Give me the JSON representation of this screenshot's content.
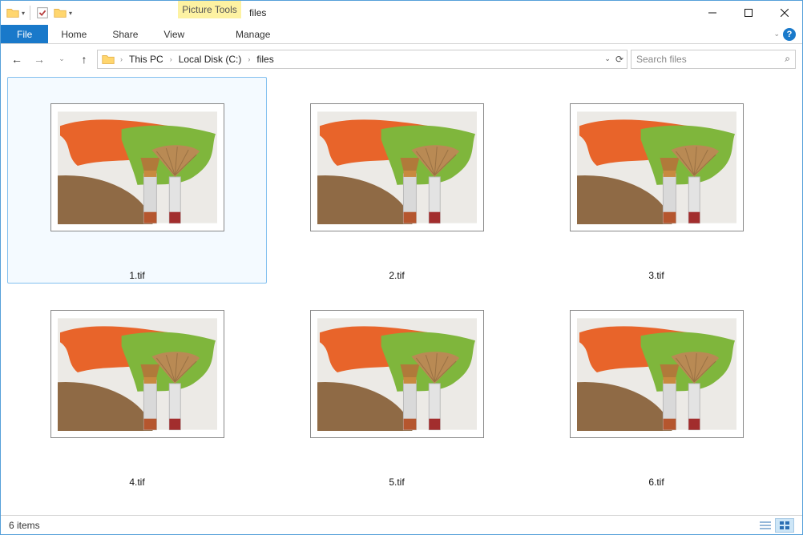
{
  "window": {
    "title": "files",
    "contextual_tab": "Picture Tools"
  },
  "tabs": {
    "file": "File",
    "home": "Home",
    "share": "Share",
    "view": "View",
    "manage": "Manage"
  },
  "breadcrumbs": [
    "This PC",
    "Local Disk (C:)",
    "files"
  ],
  "search": {
    "placeholder": "Search files"
  },
  "files": [
    {
      "name": "1.tif",
      "selected": true
    },
    {
      "name": "2.tif",
      "selected": false
    },
    {
      "name": "3.tif",
      "selected": false
    },
    {
      "name": "4.tif",
      "selected": false
    },
    {
      "name": "5.tif",
      "selected": false
    },
    {
      "name": "6.tif",
      "selected": false
    }
  ],
  "status": {
    "count_label": "6 items"
  }
}
